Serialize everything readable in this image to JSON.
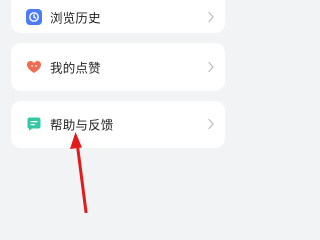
{
  "menu": {
    "items": [
      {
        "label": "浏览历史",
        "icon": "clock-icon",
        "color": "#4b7cf3"
      },
      {
        "label": "我的点赞",
        "icon": "heart-icon",
        "color": "#f06b52"
      },
      {
        "label": "帮助与反馈",
        "icon": "feedback-icon",
        "color": "#33c7a3"
      }
    ]
  },
  "annotation": {
    "color": "#e11b1b"
  }
}
